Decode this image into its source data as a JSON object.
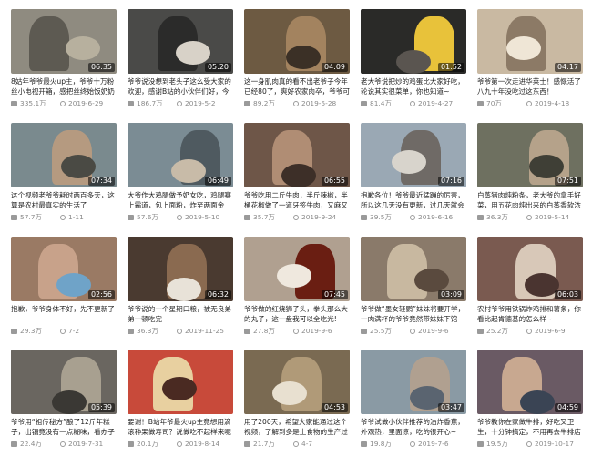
{
  "videos": [
    {
      "duration": "06:35",
      "title": "8姑年爷爷最火up主，爷爷十万粉丝小电视开箱，感把丝终始饭奶奶打",
      "views": "335.1万",
      "date": "2019-6-29",
      "bg": "#8f8b80",
      "c1": "#5d5a52",
      "c2": "#b7b09e"
    },
    {
      "duration": "05:20",
      "title": "爷爷说没想到老头子这么受大家的欢迎，感谢B站的小伙伴们好，今天",
      "views": "186.7万",
      "date": "2019-5-2",
      "bg": "#4a4a48",
      "c1": "#2b2b2a",
      "c2": "#d8d2c8"
    },
    {
      "duration": "04:09",
      "title": "这一身肌肉真的看不出老爷子今年已经80了，爽好农家肉卒，爷爷可",
      "views": "89.2万",
      "date": "2019-5-28",
      "bg": "#6d5a42",
      "c1": "#a3835f",
      "c2": "#3b3026"
    },
    {
      "duration": "01:52",
      "title": "老大爷说把炒的鸡蛋比大家好吃，轮说其实很菜单，你也知道~",
      "views": "81.4万",
      "date": "2019-4-27",
      "bg": "#2a2a28",
      "c1": "#e8c23a",
      "c2": "#5a5550"
    },
    {
      "duration": "04:17",
      "title": "爷爷第一次走进华莱士！感慨活了八九十年没吃过这东西！",
      "views": "70万",
      "date": "2019-4-18",
      "bg": "#c9b9a2",
      "c1": "#8c7a66",
      "c2": "#efe6d6"
    },
    {
      "duration": "07:34",
      "title": "这个视频老爷爷耗时两百多天，这算是农村最真实的生活了",
      "views": "57.7万",
      "date": "1-11",
      "bg": "#7a8a8e",
      "c1": "#b59a80",
      "c2": "#4a4a44"
    },
    {
      "duration": "06:49",
      "title": "大爷作大鸡腿做予奶女吃，鸡腿赛上霸道，包上面粉，炸至两面金",
      "views": "57.6万",
      "date": "2019-5-10",
      "bg": "#7b8c94",
      "c1": "#4f5a60",
      "c2": "#c8bba8"
    },
    {
      "duration": "06:55",
      "title": "爷爷吃用二斤牛肉，半斤辣椒，半桶花椒做了一道牙签牛肉，又麻又",
      "views": "35.7万",
      "date": "2019-9-24",
      "bg": "#6e5648",
      "c1": "#b08d74",
      "c2": "#3d2f28"
    },
    {
      "duration": "07:16",
      "title": "抱歉各位！爷爷最近猛蹦的厉害，所以这几天没有更新，过几天就会",
      "views": "39.5万",
      "date": "2019-6-16",
      "bg": "#9aa8b4",
      "c1": "#6f6a66",
      "c2": "#d8d4cc"
    },
    {
      "duration": "07:51",
      "title": "白蒸猪肉炖粉条，老大爷的拿手好菜，用五花肉炖出来的白蒸香软浓",
      "views": "36.3万",
      "date": "2019-5-14",
      "bg": "#6e7060",
      "c1": "#b5a28a",
      "c2": "#3f3f36"
    },
    {
      "duration": "02:56",
      "title": "抱歉，爷爷身体不好，先不更新了",
      "views": "29.3万",
      "date": "7-2",
      "bg": "#9a7a64",
      "c1": "#c8a28a",
      "c2": "#6fa3c8"
    },
    {
      "duration": "06:32",
      "title": "爷爷说的一个星期口粮，被无良弟弟一顿吃完",
      "views": "36.3万",
      "date": "2019-11-25",
      "bg": "#4a3a30",
      "c1": "#8a6a50",
      "c2": "#e8e2d8"
    },
    {
      "duration": "07:45",
      "title": "爷爷做的红烧狮子头，拳头那么大的丸子，这一盘我可以全吃光!",
      "views": "27.8万",
      "date": "2019-9-6",
      "bg": "#b0a090",
      "c1": "#6a1e12",
      "c2": "#efe8de"
    },
    {
      "duration": "03:09",
      "title": "爷爷做“墨女轻鹦”妹妹将要开学，一肉满杯的爷爷竟然带妹妹下馆",
      "views": "25.5万",
      "date": "2019-9-6",
      "bg": "#8a7a6a",
      "c1": "#c8b8a0",
      "c2": "#5a4a3e"
    },
    {
      "duration": "06:03",
      "title": "农村爷爷用铁锅炸鸡排和薯条，你看比起肯德基的怎么样~",
      "views": "25.2万",
      "date": "2019-6-9",
      "bg": "#7a5a50",
      "c1": "#d8c8b8",
      "c2": "#4a3430"
    },
    {
      "duration": "05:39",
      "title": "爷爷用“祖传秘方”酿了12斤年糕子，出锅竟没有一点糊味，看办子",
      "views": "22.4万",
      "date": "2019-7-31",
      "bg": "#6a6660",
      "c1": "#a8a090",
      "c2": "#3a3834"
    },
    {
      "duration": "",
      "title": "要谢！B站年爷最火up主竟想用滴滚种果做寿司？说做吃不起样来呢~",
      "views": "20.1万",
      "date": "2019-8-14",
      "bg": "#c84a3a",
      "c1": "#e8d0a0",
      "c2": "#4a2a22"
    },
    {
      "duration": "04:53",
      "title": "用了200天，希望大家能通过这个视频，了解到多是上食物的生产过",
      "views": "21.7万",
      "date": "4-7",
      "bg": "#7a6a52",
      "c1": "#b09a78",
      "c2": "#e8e0d0"
    },
    {
      "duration": "03:47",
      "title": "爷爷试做小伙伴推荐的油炸香蕉，外观热，里面凉，吃的很开心~",
      "views": "19.8万",
      "date": "2019-7-6",
      "bg": "#8a9aa4",
      "c1": "#b0a090",
      "c2": "#5a6470"
    },
    {
      "duration": "04:59",
      "title": "爷爷教你在家做牛排，好吃又卫生，十分钟搞定，不用再去牛排店",
      "views": "19.5万",
      "date": "2019-10-17",
      "bg": "#6a5a64",
      "c1": "#c8a890",
      "c2": "#3a4454"
    }
  ],
  "icons": {
    "views": "play-count-icon",
    "date": "clock-icon"
  }
}
